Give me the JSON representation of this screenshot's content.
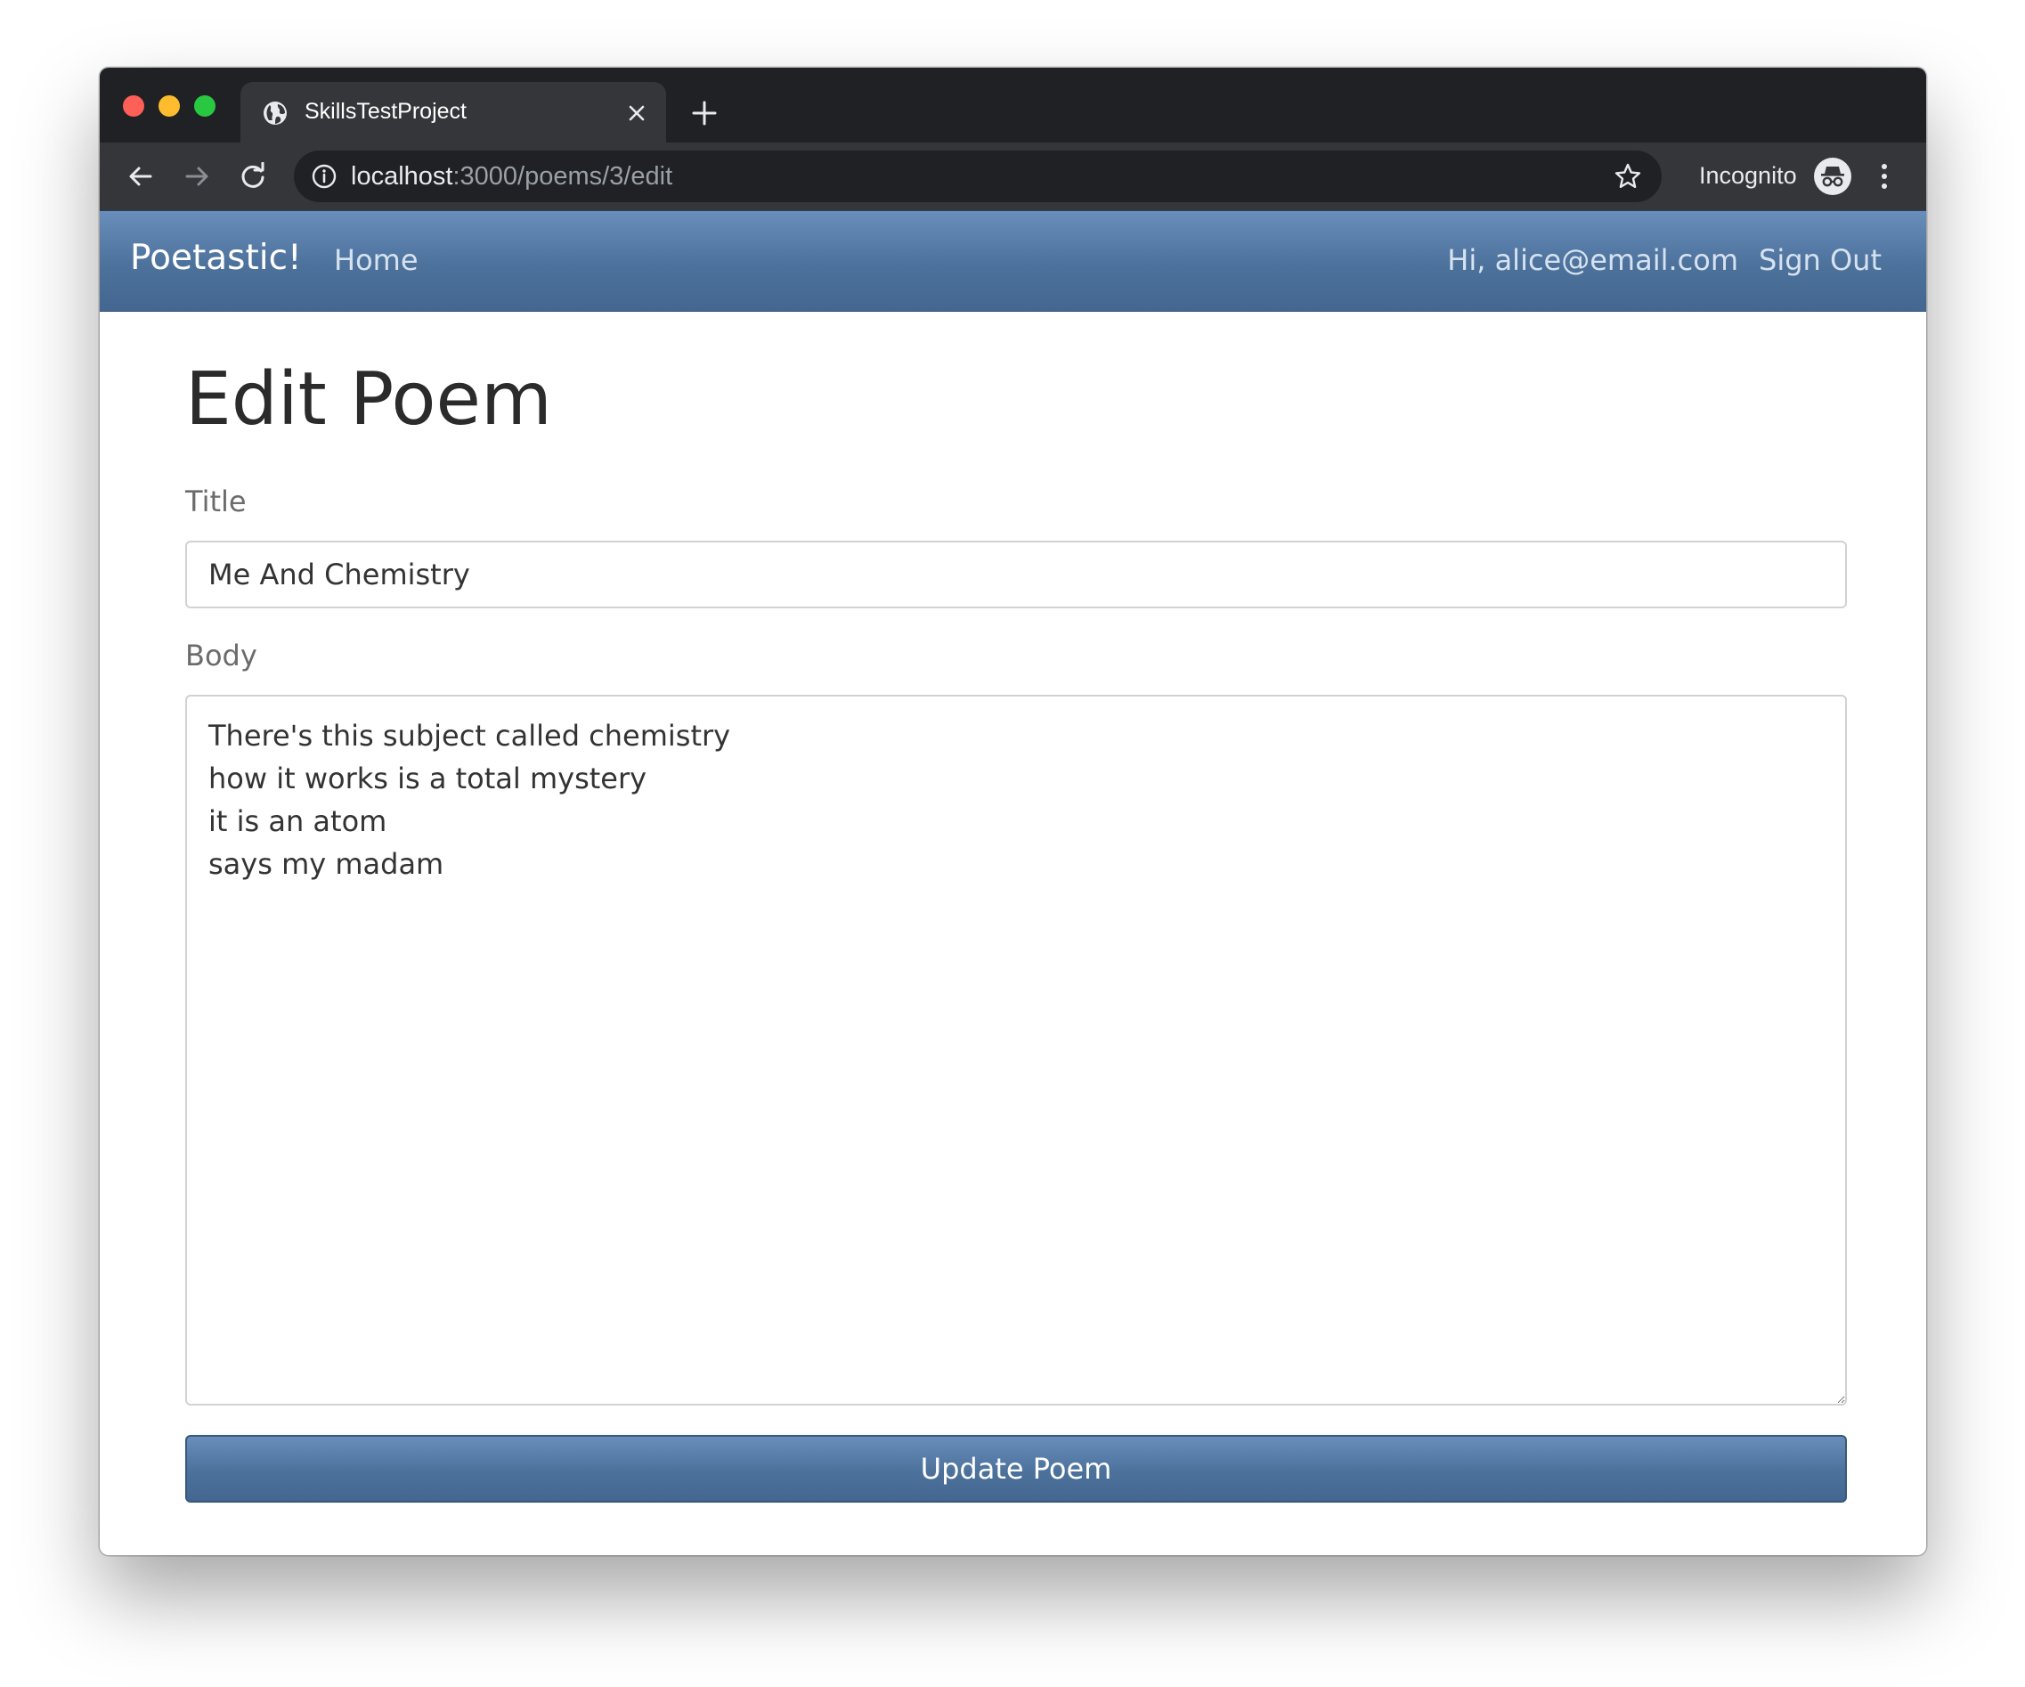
{
  "browser": {
    "tab_title": "SkillsTestProject",
    "url_host": "localhost",
    "url_path": ":3000/poems/3/edit",
    "profile_label": "Incognito",
    "icons": [
      "globe-icon",
      "close-icon",
      "plus-icon",
      "back-arrow-icon",
      "forward-arrow-icon",
      "reload-icon",
      "info-icon",
      "star-icon",
      "incognito-icon",
      "kebab-menu-icon"
    ]
  },
  "navbar": {
    "brand": "Poetastic!",
    "home_link": "Home",
    "greeting": "Hi, alice@email.com",
    "signout_link": "Sign Out"
  },
  "page": {
    "title": "Edit Poem"
  },
  "form": {
    "title_label": "Title",
    "title_value": "Me And Chemistry",
    "body_label": "Body",
    "body_value": "There's this subject called chemistry\nhow it works is a total mystery\nit is an atom\nsays my madam",
    "submit_label": "Update Poem"
  },
  "colors": {
    "navbar_top": "#6a8ebb",
    "navbar_bottom": "#436790",
    "browser_frame": "#202124",
    "browser_toolbar": "#35363a"
  }
}
